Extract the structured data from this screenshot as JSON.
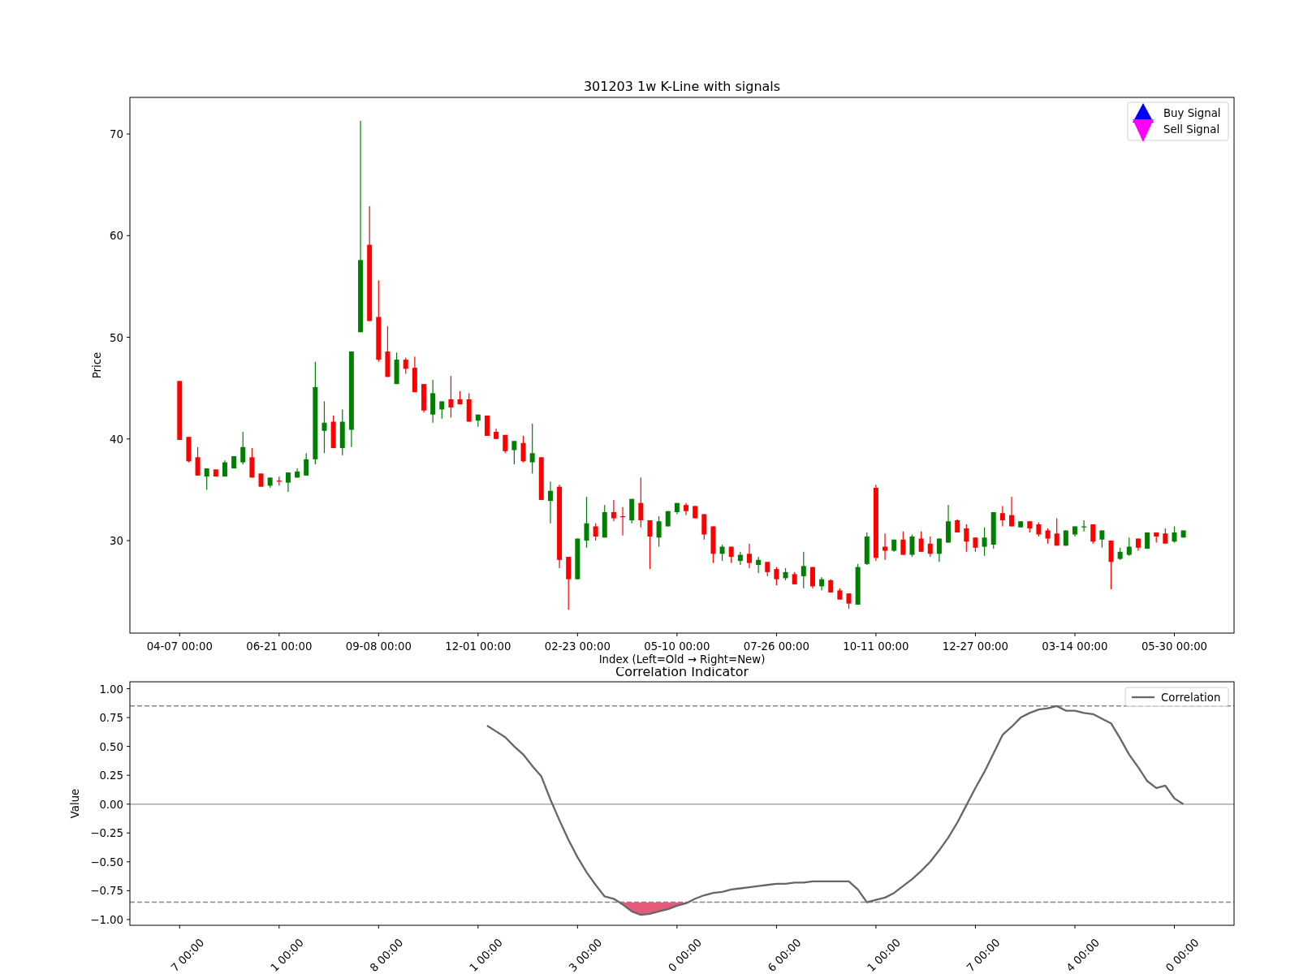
{
  "price_chart": {
    "chart_data": {
      "type": "candlestick",
      "title": "301203 1w K-Line with signals",
      "xlabel": "Index (Left=Old → Right=New)",
      "ylabel": "Price",
      "ylim": [
        20.9,
        73.6
      ],
      "categories": [
        "04-07 00:00",
        null,
        null,
        null,
        null,
        null,
        null,
        null,
        null,
        null,
        null,
        "06-21 00:00",
        null,
        null,
        null,
        null,
        null,
        null,
        null,
        null,
        null,
        null,
        "09-08 00:00",
        null,
        null,
        null,
        null,
        null,
        null,
        null,
        null,
        null,
        null,
        "12-01 00:00",
        null,
        null,
        null,
        null,
        null,
        null,
        null,
        null,
        null,
        null,
        "02-23 00:00",
        null,
        null,
        null,
        null,
        null,
        null,
        null,
        null,
        null,
        null,
        "05-10 00:00",
        null,
        null,
        null,
        null,
        null,
        null,
        null,
        null,
        null,
        null,
        "07-26 00:00",
        null,
        null,
        null,
        null,
        null,
        null,
        null,
        null,
        null,
        null,
        "10-11 00:00",
        null,
        null,
        null,
        null,
        null,
        null,
        null,
        null,
        null,
        null,
        "12-27 00:00",
        null,
        null,
        null,
        null,
        null,
        null,
        null,
        null,
        null,
        null,
        "03-14 00:00",
        null,
        null,
        null,
        null,
        null,
        null,
        null,
        null,
        null,
        null,
        "05-30 00:00",
        null
      ],
      "yticks": [
        {
          "value": 30,
          "label": "30"
        },
        {
          "value": 40,
          "label": "40"
        },
        {
          "value": 50,
          "label": "50"
        },
        {
          "value": 60,
          "label": "60"
        },
        {
          "value": 70,
          "label": "70"
        }
      ],
      "ohlc": [
        [
          45.7,
          45.7,
          39.9,
          39.9
        ],
        [
          40.2,
          40.2,
          37.7,
          37.8
        ],
        [
          38.2,
          39.2,
          36.4,
          36.4
        ],
        [
          36.3,
          37.1,
          35.0,
          37.1
        ],
        [
          37.0,
          37.0,
          36.3,
          36.3
        ],
        [
          36.3,
          37.9,
          36.3,
          37.7
        ],
        [
          37.1,
          38.3,
          37.1,
          38.3
        ],
        [
          37.7,
          40.7,
          37.5,
          39.2
        ],
        [
          38.2,
          39.1,
          36.2,
          36.2
        ],
        [
          36.6,
          36.6,
          35.3,
          35.3
        ],
        [
          35.4,
          36.2,
          35.2,
          36.2
        ],
        [
          35.9,
          36.3,
          35.4,
          35.8
        ],
        [
          35.7,
          36.7,
          34.8,
          36.7
        ],
        [
          36.2,
          37.1,
          36.2,
          36.8
        ],
        [
          36.4,
          38.6,
          36.4,
          38.0
        ],
        [
          38.0,
          47.6,
          37.5,
          45.1
        ],
        [
          40.8,
          43.7,
          38.6,
          41.6
        ],
        [
          41.7,
          42.3,
          39.1,
          39.1
        ],
        [
          39.1,
          42.9,
          38.4,
          41.7
        ],
        [
          40.9,
          48.6,
          39.2,
          48.6
        ],
        [
          50.5,
          71.3,
          50.5,
          57.6
        ],
        [
          59.1,
          62.9,
          51.6,
          51.6
        ],
        [
          52.0,
          55.6,
          47.6,
          47.8
        ],
        [
          48.6,
          51.1,
          46.1,
          46.1
        ],
        [
          45.4,
          48.5,
          45.4,
          47.8
        ],
        [
          47.8,
          48.0,
          46.4,
          46.9
        ],
        [
          47.0,
          48.1,
          44.6,
          44.6
        ],
        [
          45.4,
          45.4,
          42.6,
          42.8
        ],
        [
          42.4,
          45.8,
          41.6,
          44.5
        ],
        [
          42.9,
          43.7,
          42.0,
          43.7
        ],
        [
          43.9,
          46.2,
          42.1,
          43.1
        ],
        [
          43.9,
          44.7,
          43.4,
          43.4
        ],
        [
          43.9,
          44.5,
          41.7,
          41.7
        ],
        [
          41.8,
          42.4,
          41.2,
          42.4
        ],
        [
          42.3,
          42.3,
          40.3,
          40.3
        ],
        [
          40.7,
          41.0,
          40.0,
          40.0
        ],
        [
          40.4,
          40.4,
          38.6,
          38.8
        ],
        [
          38.9,
          39.8,
          37.5,
          39.8
        ],
        [
          39.6,
          40.3,
          37.7,
          37.8
        ],
        [
          37.7,
          41.5,
          36.6,
          38.6
        ],
        [
          38.2,
          38.2,
          34.0,
          34.0
        ],
        [
          33.9,
          35.8,
          31.7,
          34.9
        ],
        [
          35.3,
          35.5,
          27.3,
          28.1
        ],
        [
          28.4,
          28.4,
          23.2,
          26.2
        ],
        [
          26.2,
          30.2,
          26.2,
          30.2
        ],
        [
          30.0,
          34.3,
          29.3,
          31.7
        ],
        [
          31.4,
          31.7,
          30.0,
          30.4
        ],
        [
          30.3,
          33.5,
          30.3,
          32.8
        ],
        [
          32.8,
          34.0,
          31.9,
          32.2
        ],
        [
          32.4,
          33.3,
          30.5,
          32.3
        ],
        [
          32.0,
          34.1,
          31.7,
          34.1
        ],
        [
          33.7,
          36.2,
          31.3,
          32.0
        ],
        [
          32.0,
          32.0,
          27.2,
          30.4
        ],
        [
          30.3,
          32.4,
          29.4,
          31.9
        ],
        [
          31.4,
          32.9,
          31.4,
          32.9
        ],
        [
          32.8,
          33.7,
          32.6,
          33.7
        ],
        [
          33.5,
          33.7,
          32.5,
          32.9
        ],
        [
          33.4,
          33.4,
          32.2,
          32.2
        ],
        [
          32.6,
          32.6,
          30.1,
          30.6
        ],
        [
          31.4,
          31.4,
          27.8,
          28.7
        ],
        [
          28.7,
          29.6,
          28.0,
          29.4
        ],
        [
          29.4,
          29.4,
          27.8,
          28.4
        ],
        [
          28.0,
          28.9,
          27.6,
          28.6
        ],
        [
          28.7,
          29.7,
          27.3,
          27.8
        ],
        [
          27.6,
          28.4,
          26.8,
          28.1
        ],
        [
          27.9,
          27.9,
          26.5,
          26.9
        ],
        [
          27.2,
          27.4,
          25.6,
          26.2
        ],
        [
          26.3,
          27.3,
          26.1,
          26.9
        ],
        [
          26.7,
          26.9,
          25.7,
          25.7
        ],
        [
          26.5,
          28.9,
          25.3,
          27.5
        ],
        [
          27.4,
          27.4,
          25.3,
          25.5
        ],
        [
          25.5,
          26.4,
          25.1,
          26.2
        ],
        [
          26.1,
          26.2,
          24.9,
          24.9
        ],
        [
          25.1,
          25.3,
          24.2,
          24.2
        ],
        [
          24.8,
          24.8,
          23.3,
          23.8
        ],
        [
          23.7,
          27.7,
          23.7,
          27.4
        ],
        [
          27.7,
          30.8,
          27.6,
          30.4
        ],
        [
          35.2,
          35.5,
          28.0,
          28.3
        ],
        [
          29.4,
          30.7,
          28.1,
          29.0
        ],
        [
          29.0,
          30.1,
          28.9,
          30.1
        ],
        [
          30.1,
          30.9,
          28.6,
          28.6
        ],
        [
          28.6,
          30.6,
          28.4,
          30.4
        ],
        [
          30.2,
          30.9,
          28.9,
          28.9
        ],
        [
          29.7,
          30.4,
          28.4,
          28.7
        ],
        [
          28.7,
          30.2,
          27.9,
          30.2
        ],
        [
          29.8,
          33.5,
          29.8,
          31.9
        ],
        [
          32.0,
          32.1,
          30.8,
          30.8
        ],
        [
          31.2,
          31.6,
          28.9,
          29.9
        ],
        [
          30.3,
          30.3,
          28.9,
          29.3
        ],
        [
          29.4,
          31.3,
          28.5,
          30.3
        ],
        [
          29.6,
          32.8,
          29.2,
          32.8
        ],
        [
          32.7,
          33.4,
          31.4,
          32.0
        ],
        [
          32.5,
          34.3,
          31.4,
          31.4
        ],
        [
          31.3,
          31.9,
          31.3,
          31.9
        ],
        [
          31.9,
          31.9,
          30.8,
          31.2
        ],
        [
          31.6,
          31.8,
          30.4,
          30.6
        ],
        [
          31.0,
          31.2,
          29.7,
          30.2
        ],
        [
          30.7,
          32.2,
          29.5,
          29.5
        ],
        [
          29.5,
          31.0,
          29.5,
          31.0
        ],
        [
          30.6,
          31.4,
          30.4,
          31.4
        ],
        [
          31.3,
          32.0,
          30.9,
          31.4
        ],
        [
          31.6,
          31.6,
          29.7,
          29.9
        ],
        [
          30.1,
          31.0,
          29.3,
          31.0
        ],
        [
          30.0,
          30.0,
          25.2,
          27.9
        ],
        [
          28.2,
          29.3,
          28.1,
          28.9
        ],
        [
          28.6,
          30.3,
          28.5,
          29.4
        ],
        [
          30.2,
          30.2,
          29.0,
          29.3
        ],
        [
          29.2,
          30.8,
          29.2,
          30.8
        ],
        [
          30.8,
          30.8,
          29.8,
          30.4
        ],
        [
          30.7,
          31.2,
          29.7,
          29.7
        ],
        [
          29.9,
          31.4,
          29.8,
          30.8
        ],
        [
          30.3,
          31.0,
          30.3,
          31.0
        ]
      ]
    },
    "legend": [
      {
        "label": "Buy Signal",
        "kind": "up",
        "color": "#0000ff"
      },
      {
        "label": "Sell Signal",
        "kind": "down",
        "color": "#ff00ff"
      }
    ]
  },
  "correlation_chart": {
    "chart_data": {
      "type": "line",
      "title": "Correlation Indicator",
      "ylabel": "Value",
      "ylim": [
        -1.05,
        1.06
      ],
      "categories": [
        null,
        null,
        null,
        null,
        null,
        null,
        null,
        null,
        null,
        null,
        null,
        null,
        null,
        null,
        null,
        null,
        null,
        null,
        null,
        null,
        null,
        null,
        null,
        null,
        null,
        null,
        null,
        null,
        null,
        null,
        null,
        null,
        null,
        null,
        null,
        null,
        null,
        null,
        null,
        null,
        null,
        null,
        null,
        null,
        null,
        null,
        null,
        null,
        null,
        null,
        null,
        null,
        null,
        null,
        null,
        null,
        null,
        null,
        null,
        null,
        null,
        null,
        null,
        null,
        null,
        null,
        null,
        null,
        null,
        null,
        null,
        null,
        null,
        null,
        null,
        null,
        null,
        null,
        null,
        null,
        null,
        null,
        null,
        null,
        null,
        null,
        null,
        null,
        null,
        null,
        null,
        null,
        null,
        null,
        null,
        null,
        null,
        null,
        null,
        null,
        null,
        null,
        null,
        null,
        null,
        null,
        null,
        null,
        null,
        null,
        null,
        null
      ],
      "yticks": [
        {
          "value": 1,
          "label": "1.00"
        },
        {
          "value": 0.75,
          "label": "0.75"
        },
        {
          "value": 0.5,
          "label": "0.50"
        },
        {
          "value": 0.25,
          "label": "0.25"
        },
        {
          "value": 0,
          "label": "0.00"
        },
        {
          "value": -0.25,
          "label": "−0.25"
        },
        {
          "value": -0.5,
          "label": "−0.50"
        },
        {
          "value": -0.75,
          "label": "−0.75"
        },
        {
          "value": -1,
          "label": "−1.00"
        }
      ],
      "series": [
        {
          "name": "Correlation",
          "color": "#666666",
          "values": [
            null,
            null,
            null,
            null,
            null,
            null,
            null,
            null,
            null,
            null,
            null,
            null,
            null,
            null,
            null,
            null,
            null,
            null,
            null,
            null,
            null,
            null,
            null,
            null,
            null,
            null,
            null,
            null,
            null,
            null,
            null,
            null,
            null,
            null,
            0.68,
            0.63,
            0.58,
            0.5,
            0.43,
            0.33,
            0.24,
            0.04,
            -0.14,
            -0.31,
            -0.46,
            -0.59,
            -0.7,
            -0.8,
            -0.82,
            -0.87,
            -0.93,
            -0.96,
            -0.95,
            -0.93,
            -0.91,
            -0.88,
            -0.86,
            -0.82,
            -0.79,
            -0.77,
            -0.76,
            -0.74,
            -0.73,
            -0.72,
            -0.71,
            -0.7,
            -0.69,
            -0.69,
            -0.68,
            -0.68,
            -0.67,
            -0.67,
            -0.67,
            -0.67,
            -0.67,
            -0.74,
            -0.85,
            -0.83,
            -0.81,
            -0.77,
            -0.71,
            -0.65,
            -0.58,
            -0.5,
            -0.4,
            -0.29,
            -0.16,
            -0.01,
            0.14,
            0.28,
            0.44,
            0.6,
            0.67,
            0.75,
            0.79,
            0.82,
            0.83,
            0.85,
            0.81,
            0.81,
            0.79,
            0.78,
            0.74,
            0.7,
            0.57,
            0.43,
            0.32,
            0.2,
            0.14,
            0.16,
            0.05,
            0.0
          ]
        }
      ],
      "ref_lines": [
        {
          "axis": "y",
          "value": 0.85
        },
        {
          "axis": "y",
          "value": -0.85
        },
        {
          "axis": "y",
          "value": 0
        }
      ]
    },
    "cut_tick_labels": [
      "7 00:00",
      "1 00:00",
      "8 00:00",
      "1 00:00",
      "3 00:00",
      "0 00:00",
      "6 00:00",
      "1 00:00",
      "7 00:00",
      "4 00:00",
      "0 00:00"
    ]
  }
}
